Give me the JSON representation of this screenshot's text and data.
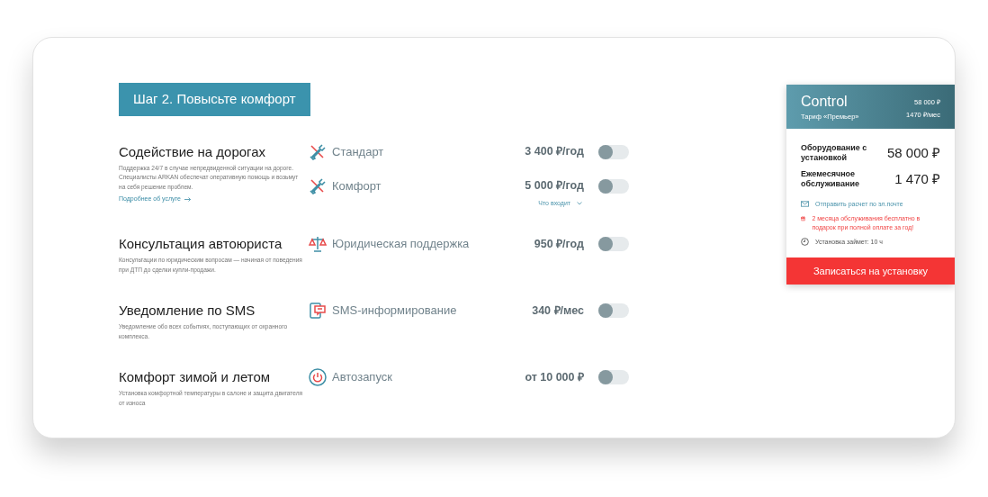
{
  "step_title": "Шаг 2. Повысьте комфорт",
  "sections": [
    {
      "title": "Содействие на дорогах",
      "description": "Поддержка 24/7 в случае непредвиденной ситуации на дороге. Специалисты ARKAN обеспечат оперативную помощь и возьмут на себя решение проблем.",
      "link": "Подробнее об услуге",
      "options": [
        {
          "kind": "tools",
          "label": "Стандарт",
          "price": "3 400 ₽/год",
          "on": false
        },
        {
          "kind": "tools",
          "label": "Комфорт",
          "price": "5 000 ₽/год",
          "on": false,
          "details": "Что входит"
        }
      ]
    },
    {
      "title": "Консультация автоюриста",
      "description": "Консультации по юридическим вопросам — начиная от поведения при ДТП до сделки купли-продажи.",
      "options": [
        {
          "kind": "scales",
          "label": "Юридическая поддержка",
          "price": "950 ₽/год",
          "on": false
        }
      ]
    },
    {
      "title": "Уведомление по SMS",
      "description": "Уведомление обо всех событиях, поступающих от охранного комплекса.",
      "options": [
        {
          "kind": "phone",
          "label": "SMS-информирование",
          "price": "340 ₽/мес",
          "on": false
        }
      ]
    },
    {
      "title": "Комфорт зимой и летом",
      "description": "Установка комфортной температуры в салоне и защита двигателя от износа",
      "options": [
        {
          "kind": "power",
          "label": "Автозапуск",
          "price": "от 10 000 ₽",
          "on": false
        }
      ]
    }
  ],
  "summary": {
    "product": "Control",
    "tariff": "Тариф «Премьер»",
    "header_price": "58 000 ₽",
    "header_monthly": "1470 ₽/мес",
    "lines": [
      {
        "label": "Оборудование с установкой",
        "value": "58 000 ₽"
      },
      {
        "label": "Ежемесячное обслуживание",
        "value": "1 470 ₽"
      }
    ],
    "notes": [
      {
        "kind": "email",
        "text": "Отправить расчет по эл.почте"
      },
      {
        "kind": "gift",
        "text": "2 месяца обслуживания бесплатно в подарок при полной оплате за год!"
      },
      {
        "kind": "clock",
        "text": "Установка займет: 10 ч"
      }
    ],
    "button": "Записаться на установку"
  }
}
